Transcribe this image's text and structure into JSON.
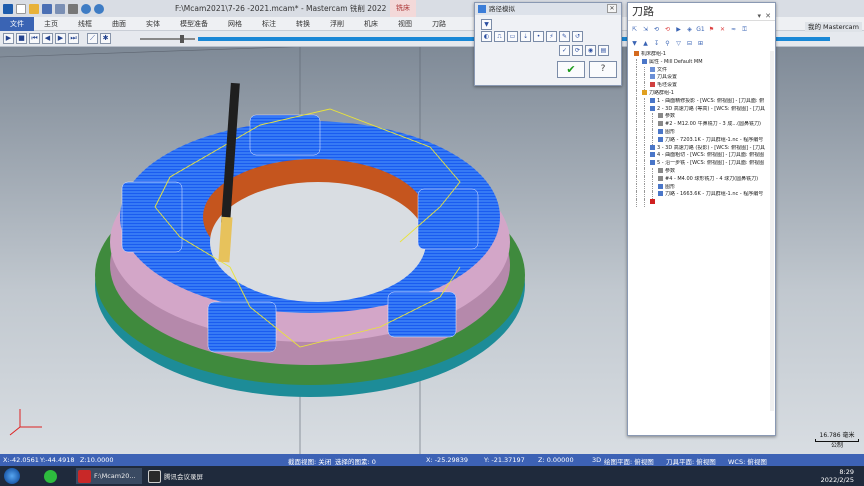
{
  "window": {
    "title": "F:\\Mcam2021\\7-26 -2021.mcam* - Mastercam 铣削 2022",
    "context_tab": "铣床"
  },
  "ribbon_tabs": [
    "文件",
    "主页",
    "线框",
    "曲面",
    "实体",
    "模型准备",
    "网格",
    "标注",
    "转换",
    "浮削",
    "机床",
    "视图",
    "刀路"
  ],
  "dialog": {
    "title": "路径模拟"
  },
  "toolpath_panel": {
    "title": "刀路",
    "tree": [
      {
        "indent": 0,
        "label": "机床群组-1",
        "icon": "folder-icon",
        "color": "#d46a1e"
      },
      {
        "indent": 1,
        "label": "属性 - Mill Default MM",
        "icon": "folder-icon",
        "color": "#4a76c8"
      },
      {
        "indent": 2,
        "label": "文件",
        "icon": "file-icon",
        "color": "#6b8fd6"
      },
      {
        "indent": 2,
        "label": "刀具设置",
        "icon": "tool-settings-icon",
        "color": "#6b8fd6"
      },
      {
        "indent": 2,
        "label": "毛坯设置",
        "icon": "stock-icon",
        "color": "#d04040"
      },
      {
        "indent": 1,
        "label": "刀路群组-1",
        "icon": "folder-icon",
        "color": "#e0a020"
      },
      {
        "indent": 2,
        "label": "1 - 曲面精修投影 - [WCS: 俯视图] - [刀具面: 俯",
        "icon": "op-icon",
        "color": "#4a76c8"
      },
      {
        "indent": 2,
        "label": "2 - 3D 高速刀路 (等高) - [WCS: 俯视图] - [刀具",
        "icon": "op-icon",
        "color": "#4a76c8"
      },
      {
        "indent": 3,
        "label": "参数",
        "icon": "params-icon",
        "color": "#888"
      },
      {
        "indent": 3,
        "label": "#2 - M12.00 牛鼻铣刀 - 3 成...(圆鼻铣刀)",
        "icon": "tool-icon",
        "color": "#888"
      },
      {
        "indent": 3,
        "label": "图形",
        "icon": "geometry-icon",
        "color": "#4a76c8"
      },
      {
        "indent": 3,
        "label": "刀路 - 7203.1K - 刀具群组-1.nc - 程序编号",
        "icon": "nc-icon",
        "color": "#4a76c8"
      },
      {
        "indent": 2,
        "label": "3 - 3D 高速刀路 (投影) - [WCS: 俯视图] - [刀具",
        "icon": "op-icon",
        "color": "#4a76c8"
      },
      {
        "indent": 2,
        "label": "4 - 曲面粗切 - [WCS: 俯视图] - [刀具面: 俯视图",
        "icon": "op-icon",
        "color": "#4a76c8"
      },
      {
        "indent": 2,
        "label": "5 - 沿一步铣 - [WCS: 俯视图] - [刀具面: 俯视图",
        "icon": "op-icon",
        "color": "#4a76c8"
      },
      {
        "indent": 3,
        "label": "参数",
        "icon": "params-icon",
        "color": "#888"
      },
      {
        "indent": 3,
        "label": "#4 - M4.00 球形铣刀 - 4 球刀(圆鼻铣刀)",
        "icon": "tool-icon",
        "color": "#888"
      },
      {
        "indent": 3,
        "label": "图形",
        "icon": "geometry-icon",
        "color": "#4a76c8"
      },
      {
        "indent": 3,
        "label": "刀路 - 1663.6K - 刀具群组-1.nc - 程序编号",
        "icon": "nc-icon",
        "color": "#4a76c8"
      },
      {
        "indent": 2,
        "label": "",
        "icon": "insert-arrow-icon",
        "color": "#d02020"
      }
    ]
  },
  "overlay": {
    "top_right_text": "我的 Mastercam",
    "scale_label": "16.786 毫米",
    "scale_unit": "公制"
  },
  "coords_bar": {
    "x_readout": "X:-42.0561",
    "y_readout": "Y:-44.4918",
    "z_readout": "Z:10.0000",
    "section_view": "截面视图: 关闭",
    "selected_entities": "选择的图素: 0",
    "x_value": "X:   -25.29839",
    "y_value": "Y:   -21.37197",
    "z_value": "Z:   0.00000",
    "mode": "3D",
    "cplane": "绘图平面: 俯视图",
    "tplane": "刀具平面: 俯视图",
    "wcs": "WCS: 俯视图"
  },
  "taskbar": {
    "items": [
      {
        "label": "",
        "icon": "wechat-icon",
        "color": "#2dbb3e"
      },
      {
        "label": "F:\\Mcam20...",
        "icon": "mastercam-icon",
        "color": "#c82828"
      },
      {
        "label": "腾讯会议录屏",
        "icon": "video-icon",
        "color": "#2a2a2a"
      }
    ],
    "time": "8:29",
    "date": "2022/2/25"
  },
  "colors": {
    "accent": "#3d62b5",
    "timeline": "#1a88d6",
    "part_pink": "#d3a6c8",
    "part_green": "#3f8a3d",
    "part_cyan": "#1d8c98",
    "toolpath_blue": "#1666ff",
    "part_orange": "#c5551e",
    "tool_yellow": "#e7c25c"
  }
}
